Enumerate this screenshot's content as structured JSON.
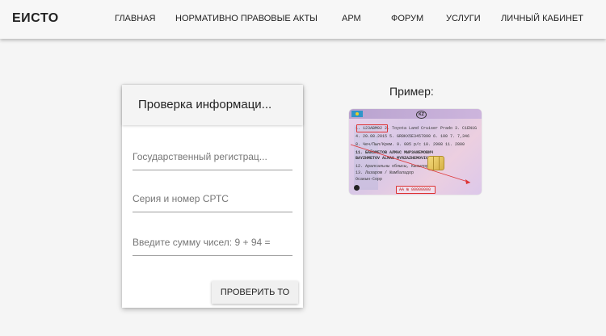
{
  "header": {
    "brand": "ЕИСТО",
    "nav": [
      "ГЛАВНАЯ",
      "НОРМАТИВНО ПРАВОВЫЕ АКТЫ",
      "АРМ",
      "ФОРУМ",
      "УСЛУГИ",
      "ЛИЧНЫЙ КАБИНЕТ"
    ]
  },
  "form": {
    "title": "Проверка информаци...",
    "fields": {
      "reg_number": {
        "placeholder": "Государственный регистрац...",
        "value": ""
      },
      "srts": {
        "placeholder": "Серия и номер СРТС",
        "value": ""
      },
      "captcha": {
        "placeholder": "Введите сумму чисел: 9 + 94 =",
        "value": ""
      }
    },
    "submit_label": "ПРОВЕРИТЬ ТО"
  },
  "example": {
    "label": "Пример:",
    "card": {
      "reg_box": "123ABM02",
      "series_box": "AA № 00000000",
      "lines": [
        "1. 123ABM02    2. Toyota Land Cruiser Prado   3. C1EN1G",
        "4. 20.08.2015  5. GR8KX5E3457890              6. 100    7. 7,346",
        "8. Чеч/Пыл/Kрем.    9. 005 р/с          10. 2908   11. 2800",
        "11. БАЙЗМЕТОВ АЛМАС МЫРЗАЖЕМОВИЧ",
        "    BAYZHMETOV ALMAS MYRZAZHEMOVICH",
        "12. Аралсальны облысы, Кызылорда",
        "13. Лазаром / Жамбаладор",
        "    Осакын-Сорр"
      ]
    }
  }
}
